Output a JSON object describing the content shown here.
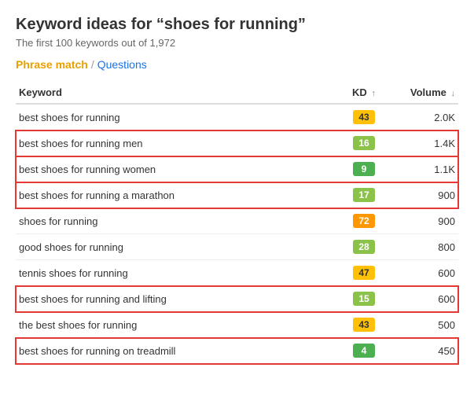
{
  "header": {
    "title": "Keyword ideas for “shoes for running”",
    "subtitle": "The first 100 keywords out of 1,972"
  },
  "tabs": {
    "active": "Phrase match",
    "separator": "/",
    "inactive": "Questions"
  },
  "table": {
    "columns": {
      "keyword": "Keyword",
      "kd": "KD",
      "volume": "Volume"
    },
    "rows": [
      {
        "keyword": "best shoes for running",
        "kd": 43,
        "kd_color": "yellow",
        "volume": "2.0K",
        "highlighted": false
      },
      {
        "keyword": "best shoes for running men",
        "kd": 16,
        "kd_color": "green-light",
        "volume": "1.4K",
        "highlighted": true
      },
      {
        "keyword": "best shoes for running women",
        "kd": 9,
        "kd_color": "green-dark",
        "volume": "1.1K",
        "highlighted": true
      },
      {
        "keyword": "best shoes for running a marathon",
        "kd": 17,
        "kd_color": "green-light",
        "volume": "900",
        "highlighted": true
      },
      {
        "keyword": "shoes for running",
        "kd": 72,
        "kd_color": "orange",
        "volume": "900",
        "highlighted": false
      },
      {
        "keyword": "good shoes for running",
        "kd": 28,
        "kd_color": "green-light",
        "volume": "800",
        "highlighted": false
      },
      {
        "keyword": "tennis shoes for running",
        "kd": 47,
        "kd_color": "yellow",
        "volume": "600",
        "highlighted": false
      },
      {
        "keyword": "best shoes for running and lifting",
        "kd": 15,
        "kd_color": "green-light",
        "volume": "600",
        "highlighted": true
      },
      {
        "keyword": "the best shoes for running",
        "kd": 43,
        "kd_color": "yellow",
        "volume": "500",
        "highlighted": false
      },
      {
        "keyword": "best shoes for running on treadmill",
        "kd": 4,
        "kd_color": "green-dark",
        "volume": "450",
        "highlighted": true
      }
    ]
  }
}
